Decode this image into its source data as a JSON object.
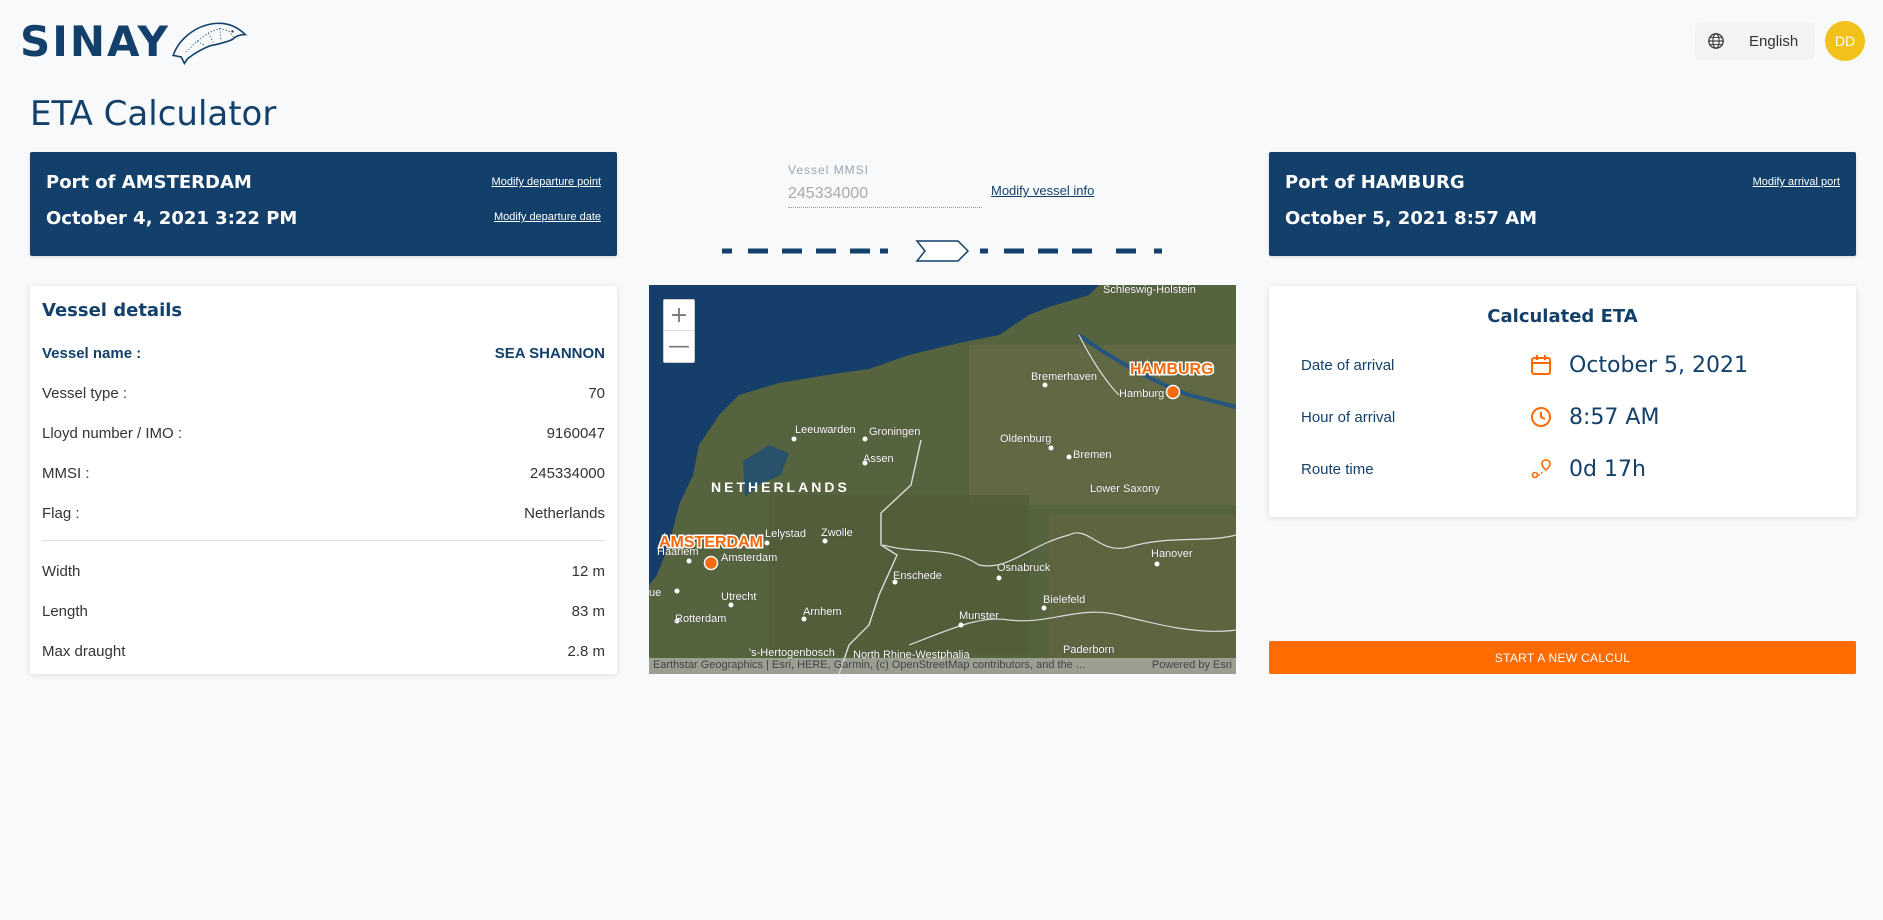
{
  "header": {
    "logo_text": "SINAY",
    "language": "English",
    "avatar_initials": "DD"
  },
  "page_title": "ETA Calculator",
  "departure": {
    "port": "Port of AMSTERDAM",
    "date": "October 4, 2021 3:22 PM",
    "modify_point_label": "Modify departure point",
    "modify_date_label": "Modify departure date"
  },
  "vessel_mmsi": {
    "label": "Vessel MMSI",
    "placeholder": "245334000",
    "modify_label": "Modify vessel info"
  },
  "arrival": {
    "port": "Port of HAMBURG",
    "date": "October 5, 2021 8:57 AM",
    "modify_port_label": "Modify arrival port"
  },
  "vessel_details": {
    "title": "Vessel details",
    "rows": [
      {
        "label": "Vessel name :",
        "value": "SEA SHANNON"
      },
      {
        "label": "Vessel type :",
        "value": "70"
      },
      {
        "label": "Lloyd number / IMO :",
        "value": "9160047"
      },
      {
        "label": "MMSI :",
        "value": "245334000"
      },
      {
        "label": "Flag :",
        "value": "Netherlands"
      },
      {
        "label": "Width",
        "value": "12 m"
      },
      {
        "label": "Length",
        "value": "83 m"
      },
      {
        "label": "Max draught",
        "value": "2.8 m"
      }
    ]
  },
  "map": {
    "zoom_in": "+",
    "zoom_out": "—",
    "labels": {
      "schleswig": "Schleswig-Holstein",
      "hamburg_marker": "HAMBURG",
      "hamburg": "Hamburg",
      "bremerhaven": "Bremerhaven",
      "leeuwarden": "Leeuwarden",
      "groningen": "Groningen",
      "oldenburg": "Oldenburg",
      "bremen": "Bremen",
      "assen": "Assen",
      "netherlands": "NETHERLANDS",
      "lower_saxony": "Lower Saxony",
      "amsterdam_marker": "AMSTERDAM",
      "haarlem": "Haarlem",
      "amsterdam": "Amsterdam",
      "lelystad": "Lelystad",
      "zwolle": "Zwolle",
      "hanover": "Hanover",
      "osnabruck": "Osnabruck",
      "enschede": "Enschede",
      "bielefeld": "Bielefeld",
      "utrecht": "Utrecht",
      "rotterdam": "Rotterdam",
      "arnhem": "Arnhem",
      "munster": "Munster",
      "paderborn": "Paderborn",
      "hertogenbosch": "'s-Hertogenbosch",
      "nrw": "North Rhine-Westphalia",
      "edge_left": "ue"
    },
    "attribution": "Earthstar Geographics | Esri, HERE, Garmin, (c) OpenStreetMap contributors, and the ...",
    "powered_by": "Powered by Esri"
  },
  "eta": {
    "title": "Calculated ETA",
    "date_label": "Date of arrival",
    "date_value": "October 5, 2021",
    "hour_label": "Hour of arrival",
    "hour_value": "8:57 AM",
    "route_label": "Route time",
    "route_value": "0d 17h"
  },
  "start_button": "START A NEW CALCUL",
  "colors": {
    "navy": "#13406b",
    "orange": "#fd6b01",
    "avatar": "#f2c21b"
  }
}
